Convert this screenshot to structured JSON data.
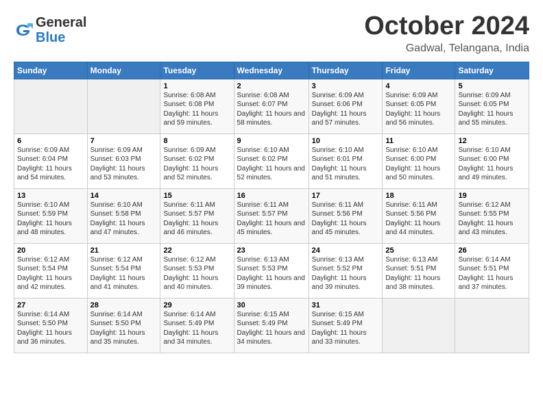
{
  "header": {
    "logo_general": "General",
    "logo_blue": "Blue",
    "month_title": "October 2024",
    "location": "Gadwal, Telangana, India"
  },
  "weekdays": [
    "Sunday",
    "Monday",
    "Tuesday",
    "Wednesday",
    "Thursday",
    "Friday",
    "Saturday"
  ],
  "weeks": [
    [
      {
        "day": null
      },
      {
        "day": null
      },
      {
        "day": "1",
        "sunrise": "6:08 AM",
        "sunset": "6:08 PM",
        "daylight": "11 hours and 59 minutes."
      },
      {
        "day": "2",
        "sunrise": "6:08 AM",
        "sunset": "6:07 PM",
        "daylight": "11 hours and 58 minutes."
      },
      {
        "day": "3",
        "sunrise": "6:09 AM",
        "sunset": "6:06 PM",
        "daylight": "11 hours and 57 minutes."
      },
      {
        "day": "4",
        "sunrise": "6:09 AM",
        "sunset": "6:05 PM",
        "daylight": "11 hours and 56 minutes."
      },
      {
        "day": "5",
        "sunrise": "6:09 AM",
        "sunset": "6:05 PM",
        "daylight": "11 hours and 55 minutes."
      }
    ],
    [
      {
        "day": "6",
        "sunrise": "6:09 AM",
        "sunset": "6:04 PM",
        "daylight": "11 hours and 54 minutes."
      },
      {
        "day": "7",
        "sunrise": "6:09 AM",
        "sunset": "6:03 PM",
        "daylight": "11 hours and 53 minutes."
      },
      {
        "day": "8",
        "sunrise": "6:09 AM",
        "sunset": "6:02 PM",
        "daylight": "11 hours and 52 minutes."
      },
      {
        "day": "9",
        "sunrise": "6:10 AM",
        "sunset": "6:02 PM",
        "daylight": "11 hours and 52 minutes."
      },
      {
        "day": "10",
        "sunrise": "6:10 AM",
        "sunset": "6:01 PM",
        "daylight": "11 hours and 51 minutes."
      },
      {
        "day": "11",
        "sunrise": "6:10 AM",
        "sunset": "6:00 PM",
        "daylight": "11 hours and 50 minutes."
      },
      {
        "day": "12",
        "sunrise": "6:10 AM",
        "sunset": "6:00 PM",
        "daylight": "11 hours and 49 minutes."
      }
    ],
    [
      {
        "day": "13",
        "sunrise": "6:10 AM",
        "sunset": "5:59 PM",
        "daylight": "11 hours and 48 minutes."
      },
      {
        "day": "14",
        "sunrise": "6:10 AM",
        "sunset": "5:58 PM",
        "daylight": "11 hours and 47 minutes."
      },
      {
        "day": "15",
        "sunrise": "6:11 AM",
        "sunset": "5:57 PM",
        "daylight": "11 hours and 46 minutes."
      },
      {
        "day": "16",
        "sunrise": "6:11 AM",
        "sunset": "5:57 PM",
        "daylight": "11 hours and 45 minutes."
      },
      {
        "day": "17",
        "sunrise": "6:11 AM",
        "sunset": "5:56 PM",
        "daylight": "11 hours and 45 minutes."
      },
      {
        "day": "18",
        "sunrise": "6:11 AM",
        "sunset": "5:56 PM",
        "daylight": "11 hours and 44 minutes."
      },
      {
        "day": "19",
        "sunrise": "6:12 AM",
        "sunset": "5:55 PM",
        "daylight": "11 hours and 43 minutes."
      }
    ],
    [
      {
        "day": "20",
        "sunrise": "6:12 AM",
        "sunset": "5:54 PM",
        "daylight": "11 hours and 42 minutes."
      },
      {
        "day": "21",
        "sunrise": "6:12 AM",
        "sunset": "5:54 PM",
        "daylight": "11 hours and 41 minutes."
      },
      {
        "day": "22",
        "sunrise": "6:12 AM",
        "sunset": "5:53 PM",
        "daylight": "11 hours and 40 minutes."
      },
      {
        "day": "23",
        "sunrise": "6:13 AM",
        "sunset": "5:53 PM",
        "daylight": "11 hours and 39 minutes."
      },
      {
        "day": "24",
        "sunrise": "6:13 AM",
        "sunset": "5:52 PM",
        "daylight": "11 hours and 39 minutes."
      },
      {
        "day": "25",
        "sunrise": "6:13 AM",
        "sunset": "5:51 PM",
        "daylight": "11 hours and 38 minutes."
      },
      {
        "day": "26",
        "sunrise": "6:14 AM",
        "sunset": "5:51 PM",
        "daylight": "11 hours and 37 minutes."
      }
    ],
    [
      {
        "day": "27",
        "sunrise": "6:14 AM",
        "sunset": "5:50 PM",
        "daylight": "11 hours and 36 minutes."
      },
      {
        "day": "28",
        "sunrise": "6:14 AM",
        "sunset": "5:50 PM",
        "daylight": "11 hours and 35 minutes."
      },
      {
        "day": "29",
        "sunrise": "6:14 AM",
        "sunset": "5:49 PM",
        "daylight": "11 hours and 34 minutes."
      },
      {
        "day": "30",
        "sunrise": "6:15 AM",
        "sunset": "5:49 PM",
        "daylight": "11 hours and 34 minutes."
      },
      {
        "day": "31",
        "sunrise": "6:15 AM",
        "sunset": "5:49 PM",
        "daylight": "11 hours and 33 minutes."
      },
      {
        "day": null
      },
      {
        "day": null
      }
    ]
  ]
}
